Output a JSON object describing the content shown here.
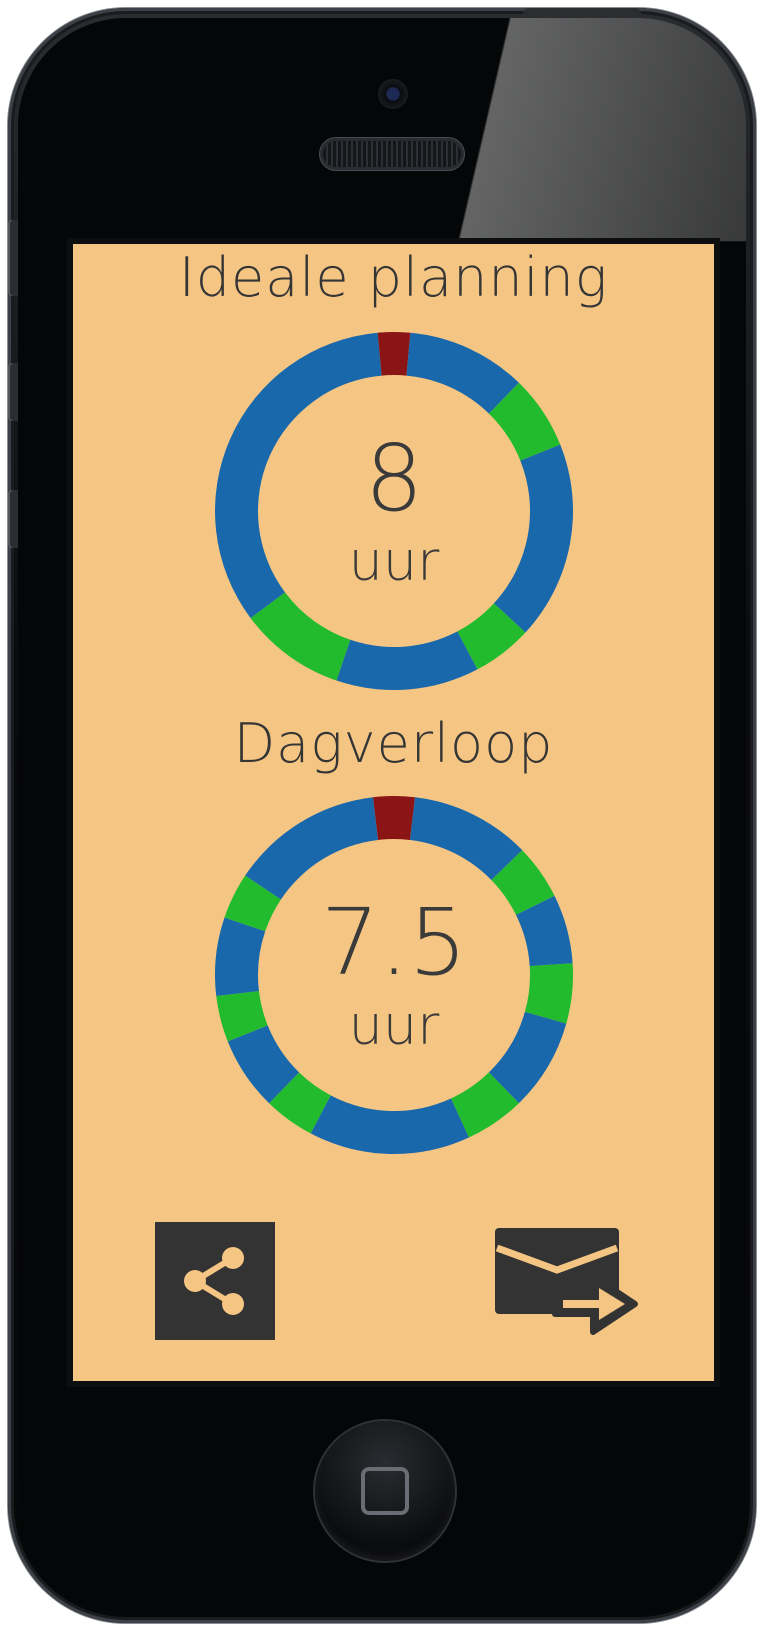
{
  "app": {
    "background_color": "#f5c683",
    "text_color": "#353535"
  },
  "colors": {
    "blue": "#1a68ac",
    "green": "#22bb2e",
    "red": "#8b1414",
    "button_dark": "#333333"
  },
  "planning": {
    "title": "Ideale planning",
    "value": "8",
    "unit": "uur",
    "segments_hours": [
      {
        "color": "red",
        "hours": 0.7
      },
      {
        "color": "blue",
        "hours": 2.6
      },
      {
        "color": "green",
        "hours": 1.6
      },
      {
        "color": "blue",
        "hours": 4.3
      },
      {
        "color": "green",
        "hours": 1.3
      },
      {
        "color": "blue",
        "hours": 3.1
      },
      {
        "color": "green",
        "hours": 2.3
      },
      {
        "color": "blue",
        "hours": 8.1
      }
    ]
  },
  "day_progress": {
    "title": "Dagverloop",
    "value": "7.5",
    "unit": "uur",
    "segments_hours": [
      {
        "color": "red",
        "hours": 0.9
      },
      {
        "color": "blue",
        "hours": 2.6
      },
      {
        "color": "green",
        "hours": 1.2
      },
      {
        "color": "blue",
        "hours": 1.5
      },
      {
        "color": "green",
        "hours": 1.3
      },
      {
        "color": "blue",
        "hours": 2.0
      },
      {
        "color": "green",
        "hours": 1.3
      },
      {
        "color": "blue",
        "hours": 3.5
      },
      {
        "color": "green",
        "hours": 1.1
      },
      {
        "color": "blue",
        "hours": 1.6
      },
      {
        "color": "green",
        "hours": 1.0
      },
      {
        "color": "blue",
        "hours": 1.7
      },
      {
        "color": "green",
        "hours": 1.0
      },
      {
        "color": "blue",
        "hours": 3.3
      }
    ]
  },
  "actions": {
    "share_icon": "share-icon",
    "mail_forward_icon": "mail-forward-icon"
  }
}
